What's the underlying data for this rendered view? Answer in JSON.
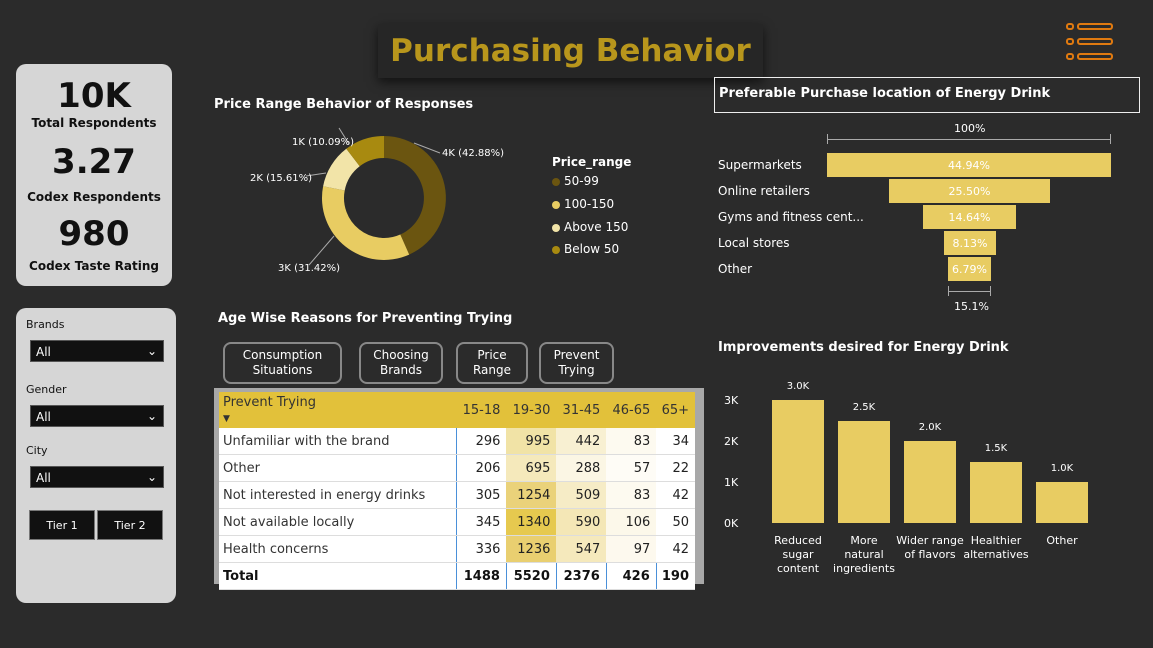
{
  "title": "Purchasing Behavior",
  "kpis": {
    "total_value": "10K",
    "total_label": "Total Respondents",
    "codex_value": "3.27",
    "codex_label": "Codex Respondents",
    "taste_value": "980",
    "taste_label": "Codex Taste Rating"
  },
  "filters": {
    "brands_label": "Brands",
    "brands_value": "All",
    "gender_label": "Gender",
    "gender_value": "All",
    "city_label": "City",
    "city_value": "All",
    "tier1": "Tier 1",
    "tier2": "Tier 2"
  },
  "price_chart": {
    "title": "Price Range Behavior of Responses",
    "legend_title": "Price_range",
    "legend": [
      "50-99",
      "100-150",
      "Above 150",
      "Below 50"
    ],
    "labels": {
      "a": "4K (42.88%)",
      "b": "3K (31.42%)",
      "c": "2K (15.61%)",
      "d": "1K (10.09%)"
    },
    "colors": [
      "#6b5510",
      "#e8cc62",
      "#f2e4a8",
      "#a88a10"
    ]
  },
  "funnel": {
    "title": "Preferable Purchase location of Energy Drink",
    "top_pct": "100%",
    "bottom_pct": "15.1%",
    "items": [
      {
        "label": "Supermarkets",
        "value": "44.94%"
      },
      {
        "label": "Online retailers",
        "value": "25.50%"
      },
      {
        "label": "Gyms and fitness cent...",
        "value": "14.64%"
      },
      {
        "label": "Local stores",
        "value": "8.13%"
      },
      {
        "label": "Other",
        "value": "6.79%"
      }
    ]
  },
  "age_section": {
    "title": "Age Wise Reasons for Preventing Trying",
    "buttons": [
      "Consumption Situations",
      "Choosing Brands",
      "Price Range",
      "Prevent Trying"
    ],
    "header": [
      "Prevent Trying",
      "15-18",
      "19-30",
      "31-45",
      "46-65",
      "65+"
    ],
    "rows": [
      [
        "Unfamiliar with the brand",
        "296",
        "995",
        "442",
        "83",
        "34"
      ],
      [
        "Other",
        "206",
        "695",
        "288",
        "57",
        "22"
      ],
      [
        "Not interested in energy drinks",
        "305",
        "1254",
        "509",
        "83",
        "42"
      ],
      [
        "Not available locally",
        "345",
        "1340",
        "590",
        "106",
        "50"
      ],
      [
        "Health concerns",
        "336",
        "1236",
        "547",
        "97",
        "42"
      ]
    ],
    "total": [
      "Total",
      "1488",
      "5520",
      "2376",
      "426",
      "190"
    ]
  },
  "improvements": {
    "title": "Improvements desired for Energy Drink",
    "y_ticks": [
      "3K",
      "2K",
      "1K",
      "0K"
    ]
  },
  "chart_data": {
    "type": "bar",
    "title": "Improvements desired for Energy Drink",
    "categories": [
      "Reduced sugar content",
      "More natural ingredients",
      "Wider range of flavors",
      "Healthier alternatives",
      "Other"
    ],
    "values": [
      3000,
      2500,
      2000,
      1500,
      1000
    ],
    "data_labels": [
      "3.0K",
      "2.5K",
      "2.0K",
      "1.5K",
      "1.0K"
    ],
    "ylim": [
      0,
      3000
    ],
    "color": "#e8cc62"
  }
}
